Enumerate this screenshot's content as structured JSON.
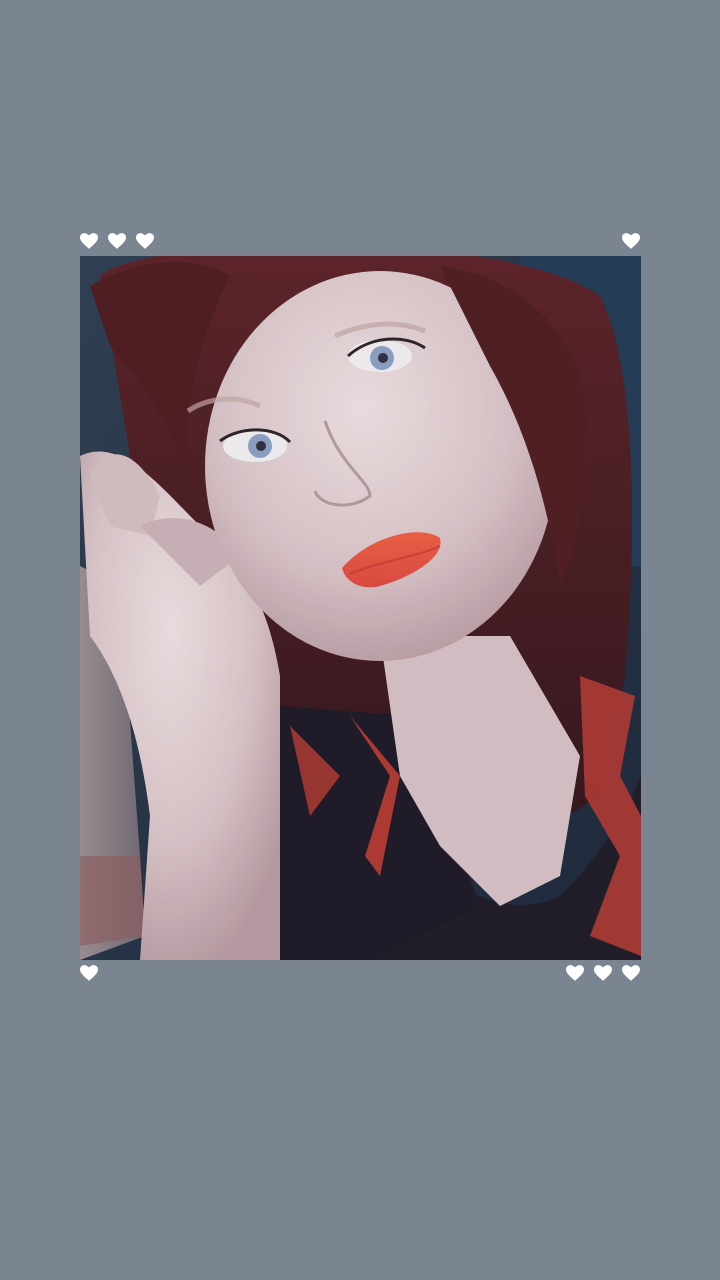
{
  "colors": {
    "background": "#7b8591",
    "heart": "#ffffff"
  },
  "hearts": {
    "top_left_count": 3,
    "top_right_count": 1,
    "bottom_left_count": 1,
    "bottom_right_count": 3,
    "icon": "heart-icon"
  },
  "photo": {
    "subject": "selfie portrait"
  }
}
